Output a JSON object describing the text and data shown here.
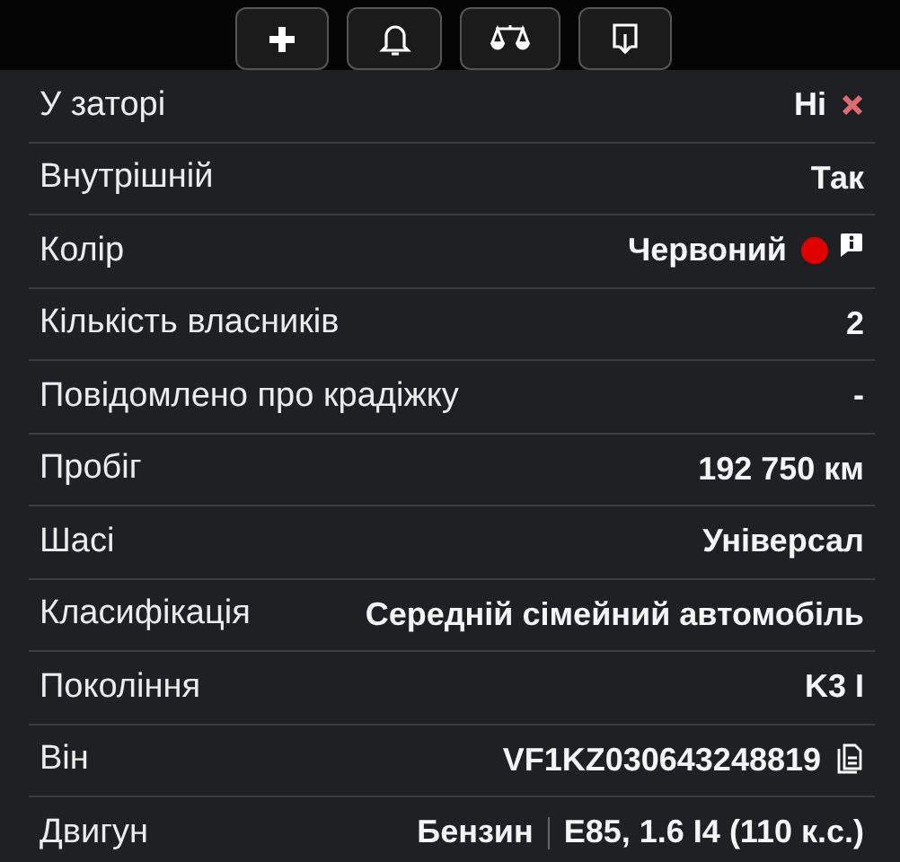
{
  "toolbar": [
    {
      "kind": "add"
    },
    {
      "kind": "alert"
    },
    {
      "kind": "compare"
    },
    {
      "kind": "export"
    }
  ],
  "rows": [
    {
      "kind": "rejected",
      "label": "У заторі",
      "value": "Ні"
    },
    {
      "kind": "plain",
      "label": "Внутрішній",
      "value": "Так"
    },
    {
      "kind": "color",
      "label": "Колір",
      "value": "Червоний",
      "color": "#e00000"
    },
    {
      "kind": "plain",
      "label": "Кількість власників",
      "value": "2"
    },
    {
      "kind": "plain",
      "label": "Повідомлено про крадіжку",
      "value": "-"
    },
    {
      "kind": "plain",
      "label": "Пробіг",
      "value": "192 750 км"
    },
    {
      "kind": "plain",
      "label": "Шасі",
      "value": "Універсал"
    },
    {
      "kind": "plain",
      "label": "Класифікація",
      "value": "Середній сімейний автомобіль"
    },
    {
      "kind": "plain",
      "label": "Покоління",
      "value": "K3 I"
    },
    {
      "kind": "copyable",
      "label": "Він",
      "value": "VF1KZ030643248819"
    },
    {
      "kind": "engine",
      "label": "Двигун",
      "value": "Бензин",
      "detail": "E85, 1.6 I4 (110 к.с.)"
    }
  ]
}
